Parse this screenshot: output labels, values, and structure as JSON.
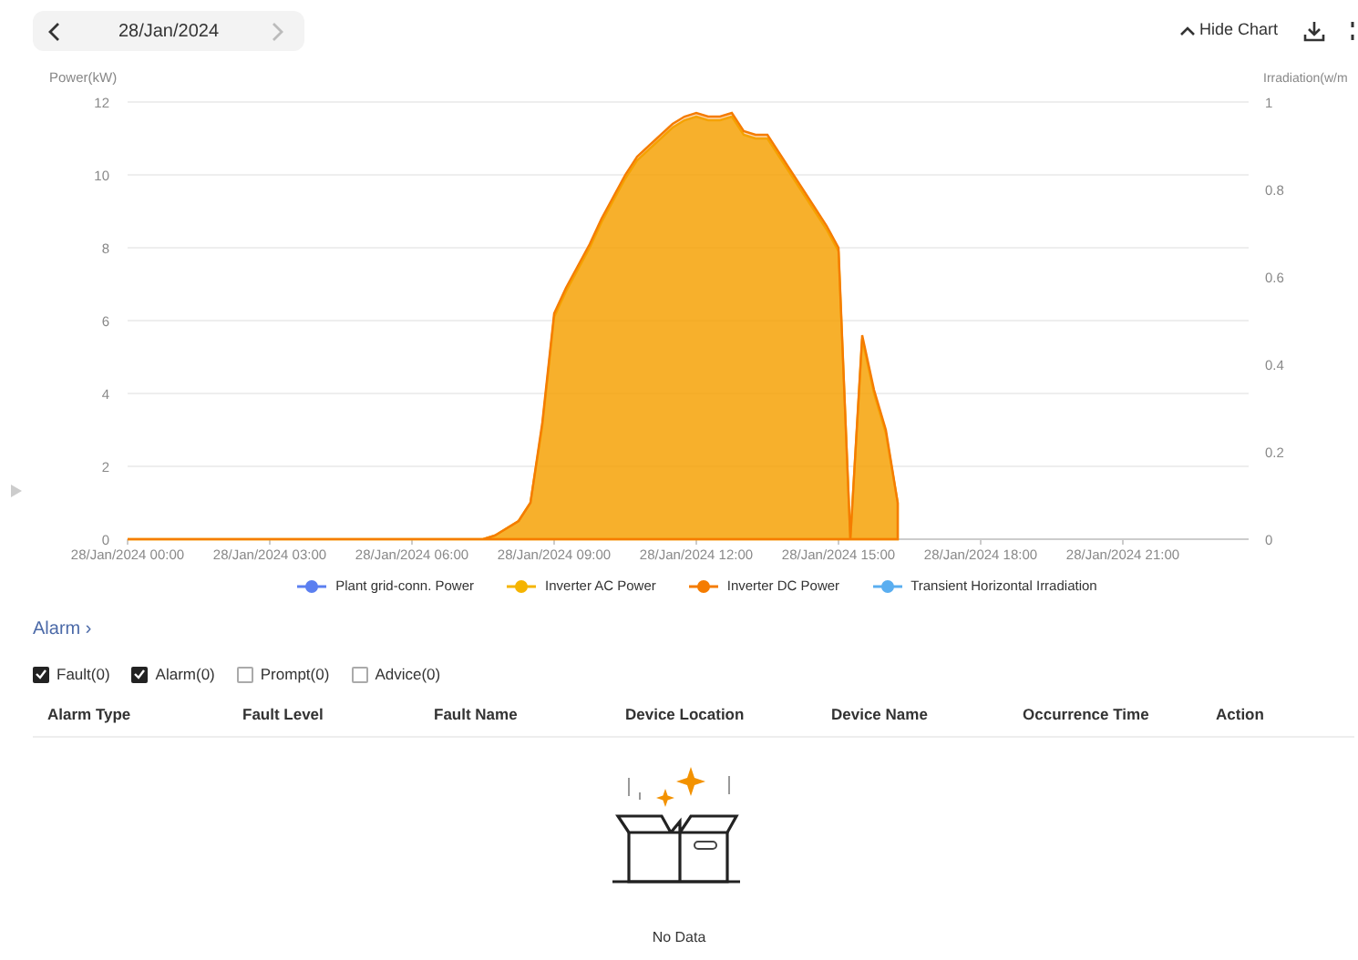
{
  "date_nav": {
    "date": "28/Jan/2024"
  },
  "toolbar": {
    "hide_chart": "Hide Chart"
  },
  "chart": {
    "chart_data": {
      "type": "area",
      "ylabel": "Power(kW)",
      "y2label": "Irradiation(w/m",
      "grid": true,
      "ylim": [
        0,
        12
      ],
      "y2lim": [
        0,
        1
      ],
      "yticks": [
        0,
        2,
        4,
        6,
        8,
        10,
        12
      ],
      "y2ticks": [
        {
          "value": 0,
          "label": "0"
        },
        {
          "value": 0.2,
          "label": "0.2"
        },
        {
          "value": 0.4,
          "label": "0.4"
        },
        {
          "value": 0.6,
          "label": "0.6"
        },
        {
          "value": 0.8,
          "label": "0.8"
        },
        {
          "value": 1,
          "label": "1"
        }
      ],
      "categories": [
        "28/Jan/2024 00:00",
        null,
        null,
        null,
        null,
        null,
        null,
        null,
        null,
        null,
        null,
        null,
        "28/Jan/2024 03:00",
        null,
        null,
        null,
        null,
        null,
        null,
        null,
        null,
        null,
        null,
        null,
        "28/Jan/2024 06:00",
        null,
        null,
        null,
        null,
        null,
        null,
        null,
        null,
        null,
        null,
        null,
        "28/Jan/2024 09:00",
        null,
        null,
        null,
        null,
        null,
        null,
        null,
        null,
        null,
        null,
        null,
        "28/Jan/2024 12:00",
        null,
        null,
        null,
        null,
        null,
        null,
        null,
        null,
        null,
        null,
        null,
        "28/Jan/2024 15:00",
        null,
        null,
        null,
        null,
        null,
        null,
        null,
        null,
        null,
        null,
        null,
        "28/Jan/2024 18:00",
        null,
        null,
        null,
        null,
        null,
        null,
        null,
        null,
        null,
        null,
        null,
        "28/Jan/2024 21:00",
        null,
        null,
        null,
        null,
        null,
        null,
        null,
        null,
        null,
        null,
        null
      ],
      "series": [
        {
          "name": "Plant grid-conn. Power",
          "color": "#5b7ff0",
          "values": [
            null,
            null,
            null,
            null,
            null,
            null,
            null,
            null,
            null,
            null,
            null,
            null,
            null,
            null,
            null,
            null,
            null,
            null,
            null,
            null,
            null,
            null,
            null,
            null,
            null,
            null,
            null,
            null,
            null,
            null,
            null,
            null,
            null,
            null,
            null,
            null,
            null,
            null,
            null,
            null,
            null,
            null,
            null,
            null,
            null,
            null,
            null,
            null,
            null,
            null,
            null,
            null,
            null,
            null,
            null,
            null,
            null,
            null,
            null,
            null,
            null,
            null,
            null,
            null,
            null,
            null,
            null,
            null,
            null,
            null,
            null,
            null,
            null,
            null,
            null,
            null,
            null,
            null,
            null,
            null,
            null,
            null,
            null,
            null,
            null,
            null,
            null,
            null,
            null,
            null,
            null,
            null,
            null,
            null,
            null,
            null
          ]
        },
        {
          "name": "Inverter AC Power",
          "color": "#f5b400",
          "values": [
            0,
            0,
            0,
            0,
            0,
            0,
            0,
            0,
            0,
            0,
            0,
            0,
            0,
            0,
            0,
            0,
            0,
            0,
            0,
            0,
            0,
            0,
            0,
            0,
            0,
            0,
            0,
            0,
            0,
            0,
            0,
            0.1,
            0.3,
            0.5,
            1,
            3.1,
            6.1,
            6.8,
            7.4,
            8,
            8.7,
            9.3,
            9.9,
            10.4,
            10.7,
            11,
            11.3,
            11.5,
            11.6,
            11.5,
            11.5,
            11.6,
            11.1,
            11,
            11,
            10.5,
            10,
            9.5,
            9,
            8.5,
            7.9,
            0,
            5.5,
            4,
            2.9,
            1,
            null,
            null,
            null,
            null,
            null,
            null,
            null,
            null,
            null,
            null,
            null,
            null,
            null,
            null,
            null,
            null,
            null,
            null,
            null,
            null,
            null,
            null,
            null,
            null,
            null,
            null,
            null,
            null,
            null,
            null
          ]
        },
        {
          "name": "Inverter DC Power",
          "color": "#f57c00",
          "values": [
            0,
            0,
            0,
            0,
            0,
            0,
            0,
            0,
            0,
            0,
            0,
            0,
            0,
            0,
            0,
            0,
            0,
            0,
            0,
            0,
            0,
            0,
            0,
            0,
            0,
            0,
            0,
            0,
            0,
            0,
            0,
            0.1,
            0.3,
            0.5,
            1,
            3.2,
            6.2,
            6.9,
            7.5,
            8.1,
            8.8,
            9.4,
            10,
            10.5,
            10.8,
            11.1,
            11.4,
            11.6,
            11.7,
            11.6,
            11.6,
            11.7,
            11.2,
            11.1,
            11.1,
            10.6,
            10.1,
            9.6,
            9.1,
            8.6,
            8,
            0,
            5.6,
            4.1,
            3,
            1,
            null,
            null,
            null,
            null,
            null,
            null,
            null,
            null,
            null,
            null,
            null,
            null,
            null,
            null,
            null,
            null,
            null,
            null,
            null,
            null,
            null,
            null,
            null,
            null,
            null,
            null,
            null,
            null,
            null,
            null
          ]
        },
        {
          "name": "Transient Horizontal Irradiation",
          "color": "#5aaef0",
          "values": [
            null,
            null,
            null,
            null,
            null,
            null,
            null,
            null,
            null,
            null,
            null,
            null,
            null,
            null,
            null,
            null,
            null,
            null,
            null,
            null,
            null,
            null,
            null,
            null,
            null,
            null,
            null,
            null,
            null,
            null,
            null,
            null,
            null,
            null,
            null,
            null,
            null,
            null,
            null,
            null,
            null,
            null,
            null,
            null,
            null,
            null,
            null,
            null,
            null,
            null,
            null,
            null,
            null,
            null,
            null,
            null,
            null,
            null,
            null,
            null,
            null,
            null,
            null,
            null,
            null,
            null,
            null,
            null,
            null,
            null,
            null,
            null,
            null,
            null,
            null,
            null,
            null,
            null,
            null,
            null,
            null,
            null,
            null,
            null,
            null,
            null,
            null,
            null,
            null,
            null,
            null,
            null,
            null,
            null,
            null,
            null
          ]
        }
      ]
    }
  },
  "alarm": {
    "title": "Alarm ›",
    "filters": [
      {
        "label": "Fault(0)",
        "checked": true
      },
      {
        "label": "Alarm(0)",
        "checked": true
      },
      {
        "label": "Prompt(0)",
        "checked": false
      },
      {
        "label": "Advice(0)",
        "checked": false
      }
    ],
    "table": {
      "columns": [
        "Alarm Type",
        "Fault Level",
        "Fault Name",
        "Device Location",
        "Device Name",
        "Occurrence Time",
        "Action"
      ],
      "empty_text": "No Data"
    }
  }
}
